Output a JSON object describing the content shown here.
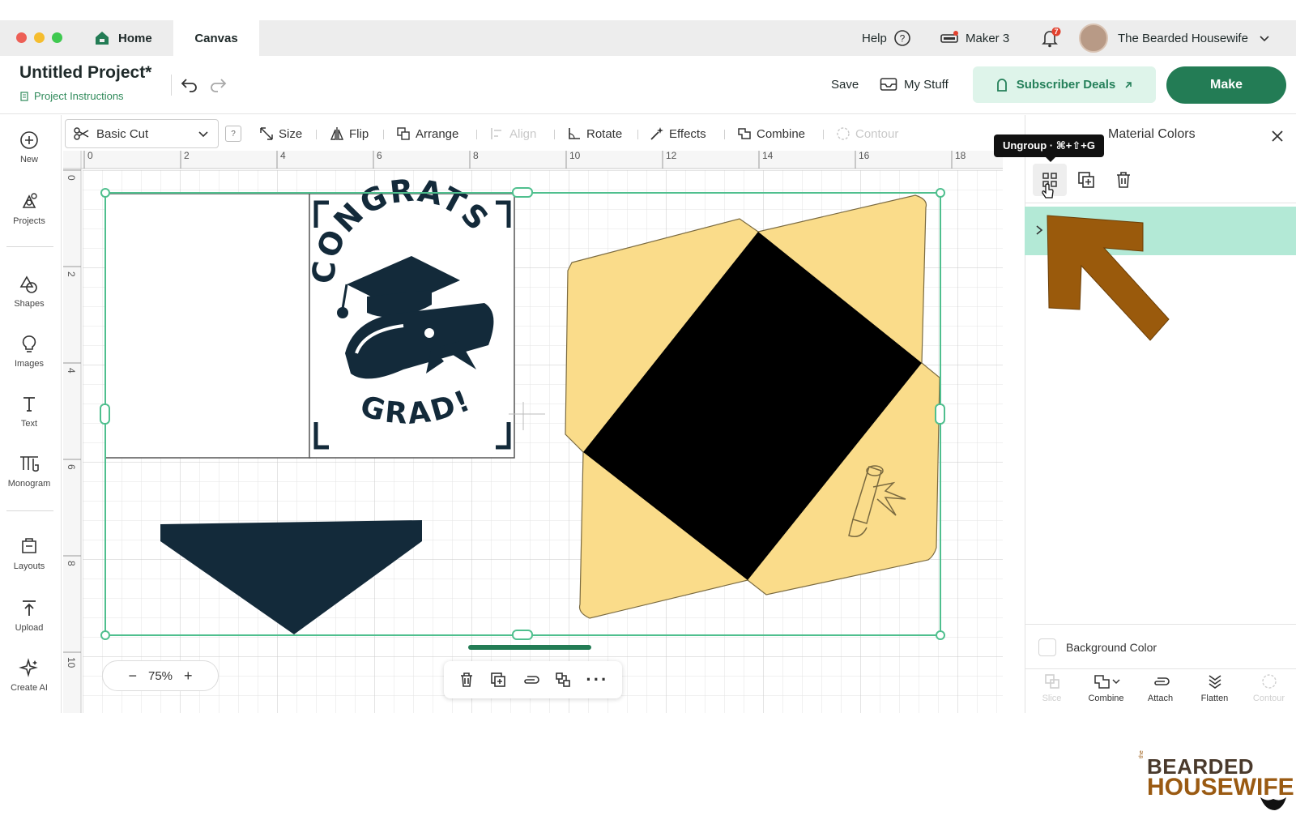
{
  "tabs": {
    "home": "Home",
    "canvas": "Canvas"
  },
  "top_right": {
    "help": "Help",
    "machine": "Maker 3",
    "notifications": "7",
    "user": "The Bearded Housewife"
  },
  "project": {
    "title": "Untitled Project*",
    "instructions": "Project Instructions"
  },
  "header": {
    "save": "Save",
    "my_stuff": "My Stuff",
    "deals": "Subscriber Deals",
    "make": "Make"
  },
  "left_rail": [
    {
      "label": "New",
      "icon": "plus-circle-icon"
    },
    {
      "label": "Projects",
      "icon": "projects-icon"
    },
    {
      "label": "Shapes",
      "icon": "shapes-icon"
    },
    {
      "label": "Images",
      "icon": "lightbulb-icon"
    },
    {
      "label": "Text",
      "icon": "text-icon"
    },
    {
      "label": "Monogram",
      "icon": "monogram-icon"
    },
    {
      "label": "Layouts",
      "icon": "layouts-icon"
    },
    {
      "label": "Upload",
      "icon": "upload-icon"
    },
    {
      "label": "Create AI",
      "icon": "sparkle-icon"
    }
  ],
  "toolbar": {
    "operation": "Basic Cut",
    "help": "?",
    "size": "Size",
    "flip": "Flip",
    "arrange": "Arrange",
    "align": "Align",
    "rotate": "Rotate",
    "effects": "Effects",
    "combine": "Combine",
    "contour": "Contour"
  },
  "ruler": {
    "top": [
      "0",
      "2",
      "4",
      "6",
      "8",
      "10",
      "12",
      "14",
      "16",
      "18"
    ],
    "left": [
      "0",
      "2",
      "4",
      "6",
      "8",
      "10"
    ]
  },
  "canvas": {
    "congrats": "CONGRATS",
    "grad": "GRAD!",
    "zoom": "75%"
  },
  "panel": {
    "tooltip": "Ungroup · ⌘+⇧+G",
    "title": "Material Colors",
    "background_color": "Background Color",
    "bottom_tools": [
      {
        "label": "Slice",
        "disabled": true
      },
      {
        "label": "Combine",
        "disabled": false
      },
      {
        "label": "Attach",
        "disabled": false
      },
      {
        "label": "Flatten",
        "disabled": false
      },
      {
        "label": "Contour",
        "disabled": true
      }
    ]
  },
  "brand": {
    "the": "the",
    "line1": "BEARDED",
    "line2": "HOUSEWIFE"
  },
  "colors": {
    "accent": "#237c55",
    "envelope_fill": "#fadc8a",
    "navy": "#132a3a",
    "selection": "#4fbf8e",
    "arrow": "#9a5a0c"
  }
}
